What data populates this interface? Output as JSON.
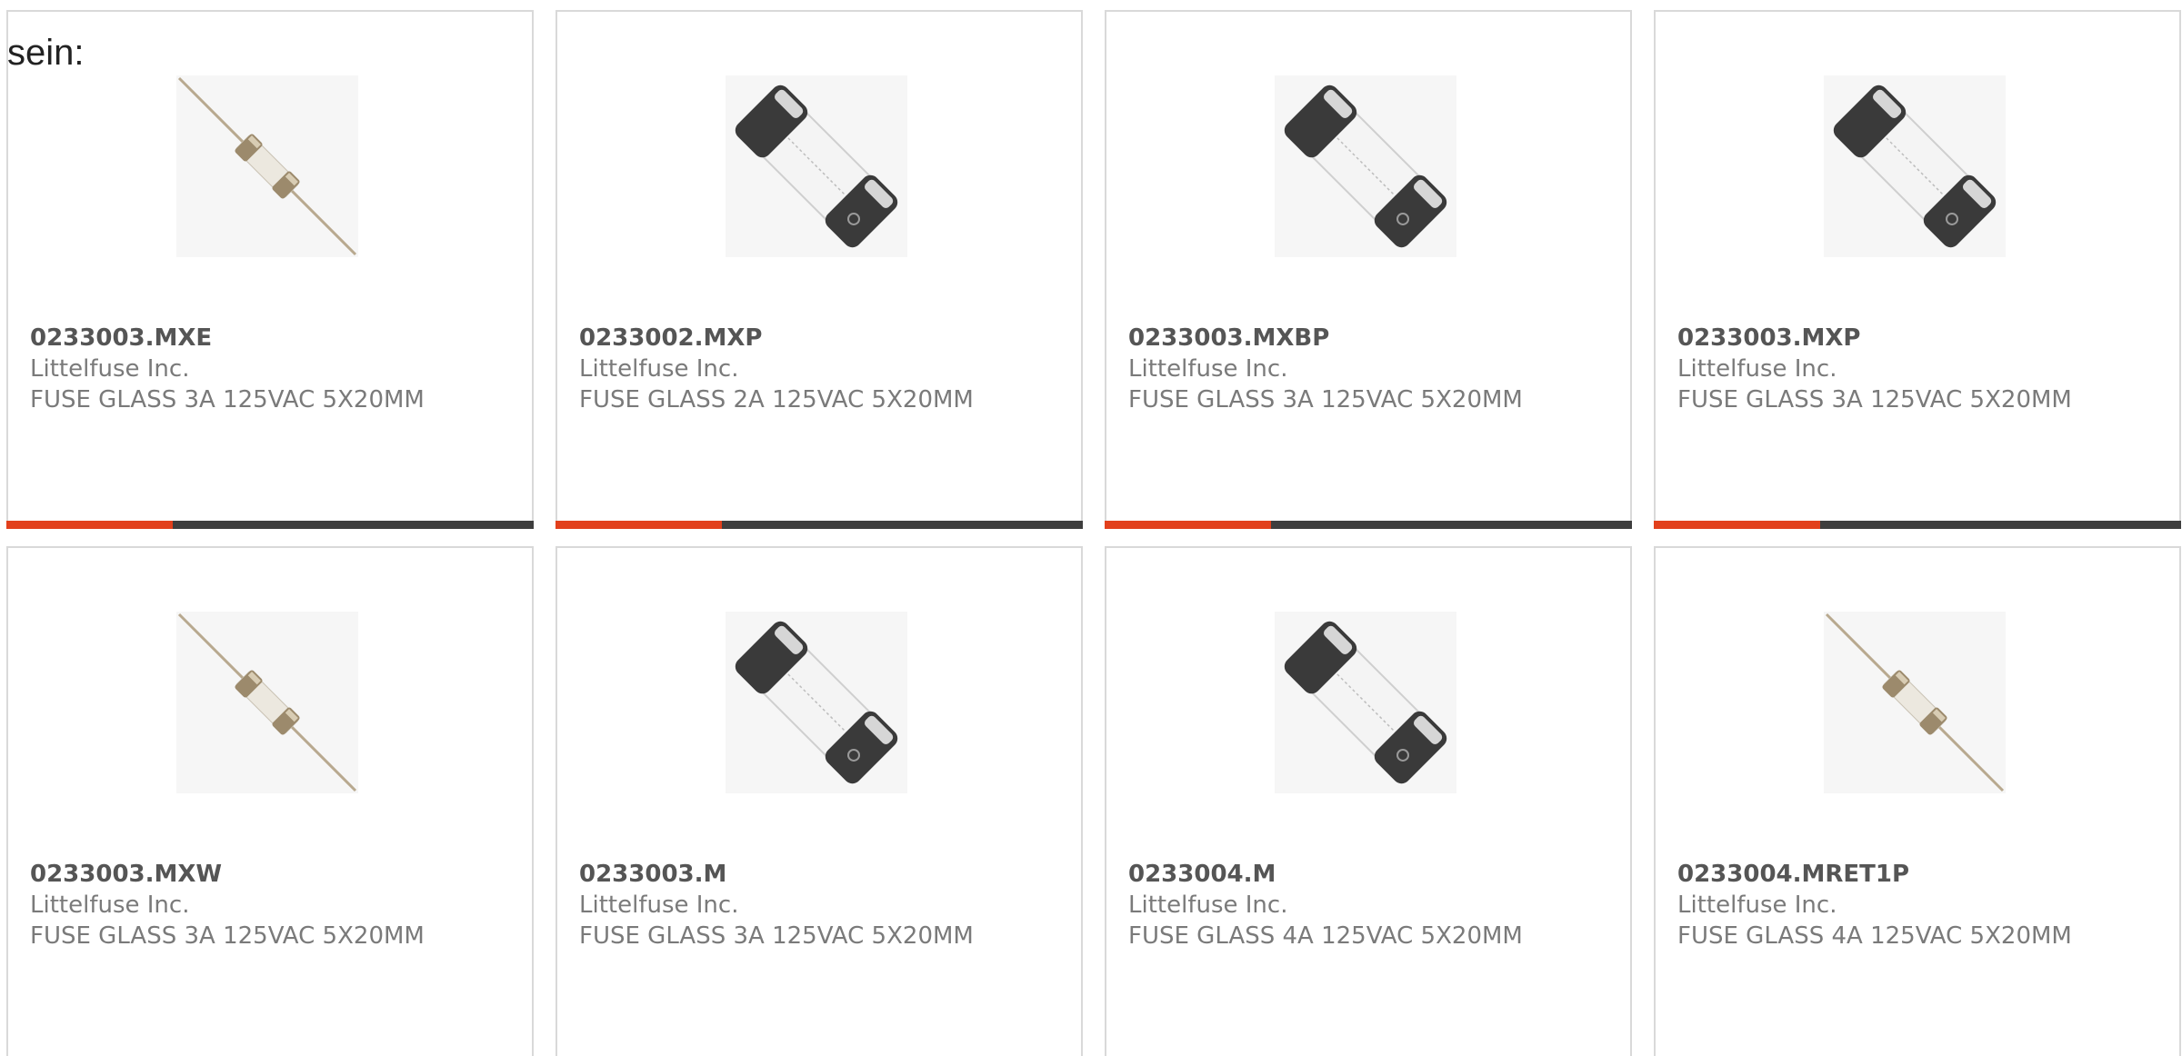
{
  "intro_text": "sein:",
  "colors": {
    "accent": "#e2401c",
    "bar": "#3e3e3e",
    "border": "#d9d9d9"
  },
  "products": [
    {
      "part_number": "0233003.MXE",
      "manufacturer": "Littelfuse Inc.",
      "description": "FUSE GLASS 3A 125VAC 5X20MM",
      "image": "axial-lead-fuse-icon"
    },
    {
      "part_number": "0233002.MXP",
      "manufacturer": "Littelfuse Inc.",
      "description": "FUSE GLASS 2A 125VAC 5X20MM",
      "image": "cartridge-fuse-icon"
    },
    {
      "part_number": "0233003.MXBP",
      "manufacturer": "Littelfuse Inc.",
      "description": "FUSE GLASS 3A 125VAC 5X20MM",
      "image": "cartridge-fuse-icon"
    },
    {
      "part_number": "0233003.MXP",
      "manufacturer": "Littelfuse Inc.",
      "description": "FUSE GLASS 3A 125VAC 5X20MM",
      "image": "cartridge-fuse-icon"
    },
    {
      "part_number": "0233003.MXW",
      "manufacturer": "Littelfuse Inc.",
      "description": "FUSE GLASS 3A 125VAC 5X20MM",
      "image": "axial-lead-fuse-icon"
    },
    {
      "part_number": "0233003.M",
      "manufacturer": "Littelfuse Inc.",
      "description": "FUSE GLASS 3A 125VAC 5X20MM",
      "image": "cartridge-fuse-icon"
    },
    {
      "part_number": "0233004.M",
      "manufacturer": "Littelfuse Inc.",
      "description": "FUSE GLASS 4A 125VAC 5X20MM",
      "image": "cartridge-fuse-icon"
    },
    {
      "part_number": "0233004.MRET1P",
      "manufacturer": "Littelfuse Inc.",
      "description": "FUSE GLASS 4A 125VAC 5X20MM",
      "image": "axial-lead-fuse-icon"
    }
  ]
}
